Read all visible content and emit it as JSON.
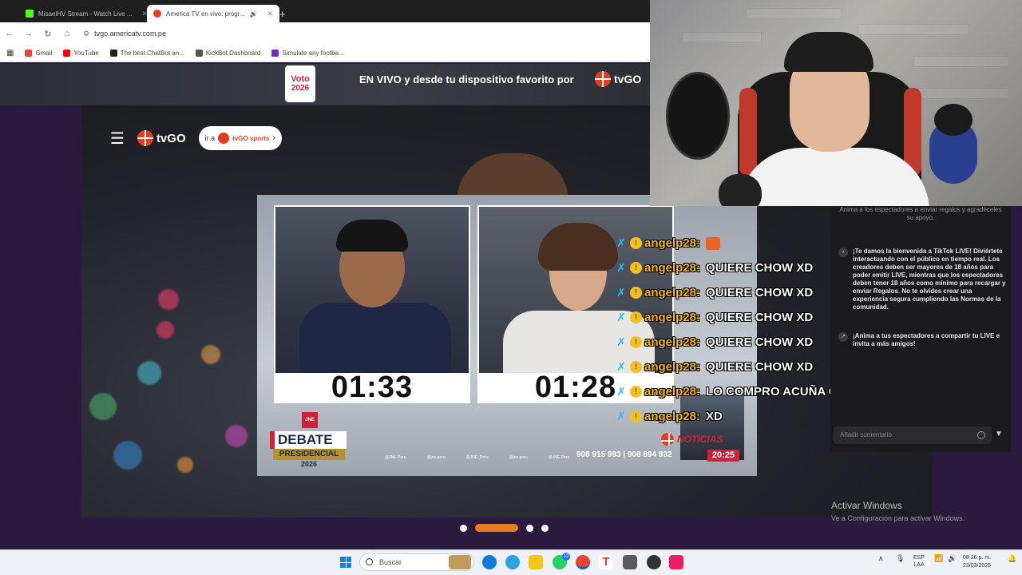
{
  "browser": {
    "tabs": [
      {
        "label": "MisaelHV Stream - Watch Live ..."
      },
      {
        "label": "America TV en vivo: progr..."
      }
    ],
    "url": "tvgo.americatv.com.pe",
    "bookmarks": [
      "Gmail",
      "YouTube",
      "The best ChatBot an...",
      "KickBot Dashboard",
      "Simulate any footba..."
    ]
  },
  "banner": {
    "voto_label": "Voto",
    "voto_year": "2026",
    "text": "EN VIVO y desde tu dispositivo favorito por",
    "logo": "tvGO"
  },
  "hero": {
    "logo": "tvGO",
    "sports_prefix": "ir a",
    "sports_label": "tvGO sports"
  },
  "player": {
    "timer_left": "01:33",
    "timer_right": "01:28",
    "jne": "JNE",
    "debate_title": "DEBATE",
    "debate_subtitle": "PRESIDENCIAL",
    "debate_year": "2026",
    "socials": [
      "@JNE.Peru",
      "@jne.peru",
      "@JNE_Peru",
      "@jne.peru",
      "@JNE.Peru"
    ],
    "phones": "908 915 993  |  908 894 932",
    "noticias": "NOTICIAS",
    "clock": "20:25"
  },
  "chat": [
    {
      "user": "angelp28:",
      "msg": "",
      "emote": true
    },
    {
      "user": "angelp28:",
      "msg": "QUIERE CHOW XD"
    },
    {
      "user": "angelp28:",
      "msg": "QUIERE CHOW XD"
    },
    {
      "user": "angelp28:",
      "msg": "QUIERE CHOW XD"
    },
    {
      "user": "angelp28:",
      "msg": "QUIERE CHOW XD"
    },
    {
      "user": "angelp28:",
      "msg": "QUIERE CHOW XD"
    },
    {
      "user": "angelp28:",
      "msg": "LO COMPRO ACUÑA CREO"
    },
    {
      "user": "angelp28:",
      "msg": "XD"
    }
  ],
  "tiktok": {
    "top": "Anima a los espectadores a enviar regalos y agradéceles su apoyo.",
    "welcome": "¡Te damos la bienvenida a TikTok LIVE! Diviértete interactuando con el público en tiempo real. Los creadores deben ser mayores de 18 años para poder emitir LIVE, mientras que los espectadores deben tener 18 años como mínimo para recargar y enviar Regalos. No te olvides crear una experiencia segura cumpliendo las Normas de la comunidad.",
    "share": "¡Anima a tus espectadores a compartir tu LIVE e invita a más amigos!",
    "placeholder": "Añadir comentario"
  },
  "windows": {
    "activate_title": "Activar Windows",
    "activate_sub": "Ve a Configuración para activar Windows."
  },
  "taskbar": {
    "search": "Buscar",
    "lang": "ESP",
    "region": "LAA",
    "time": "08:26 p. m.",
    "date": "23/03/2026",
    "whatsapp_badge": "12"
  },
  "colors": {
    "accent": "#e87a1f",
    "brand_red": "#d1203a",
    "chat_user": "#f6b81c",
    "chat_icon": "#29b9f5"
  }
}
